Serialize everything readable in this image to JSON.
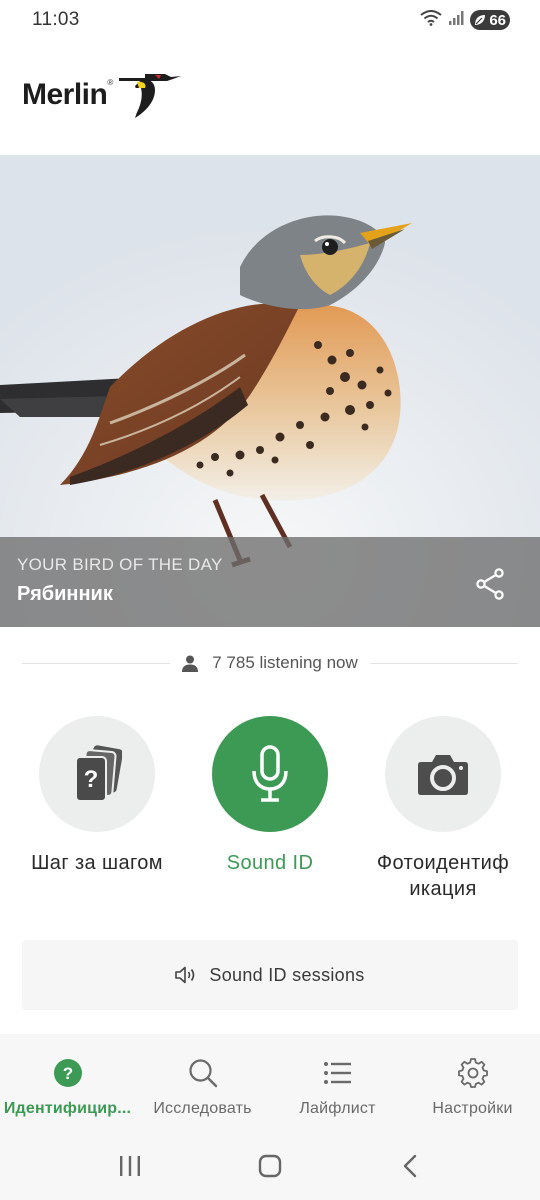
{
  "status_bar": {
    "time": "11:03",
    "battery_level": "66",
    "icons": [
      "wifi-icon",
      "signal-icon",
      "battery-icon"
    ]
  },
  "header": {
    "logo_text": "Merlin",
    "logo_mark": "®"
  },
  "hero": {
    "kicker": "YOUR BIRD OF THE DAY",
    "bird_name": "Рябинник",
    "share_icon": "share-icon"
  },
  "listening": {
    "text": "7 785 listening now",
    "icon": "person-icon"
  },
  "actions": [
    {
      "label": "Шаг за шагом",
      "icon": "question-cards-icon"
    },
    {
      "label": "Sound ID",
      "icon": "microphone-icon"
    },
    {
      "label": "Фотоидентификация",
      "label_line1": "Фотоидентиф",
      "label_line2": "икация",
      "icon": "camera-icon"
    }
  ],
  "sessions": {
    "label": "Sound ID sessions",
    "icon": "speaker-icon"
  },
  "bottom_nav": [
    {
      "label": "Идентифицир...",
      "icon": "question-circle-icon",
      "active": true
    },
    {
      "label": "Исследовать",
      "icon": "search-icon",
      "active": false
    },
    {
      "label": "Лайфлист",
      "icon": "list-icon",
      "active": false
    },
    {
      "label": "Настройки",
      "icon": "gear-icon",
      "active": false
    }
  ],
  "colors": {
    "accent_green": "#3d9a55",
    "caption_overlay": "#6e6e6e"
  }
}
